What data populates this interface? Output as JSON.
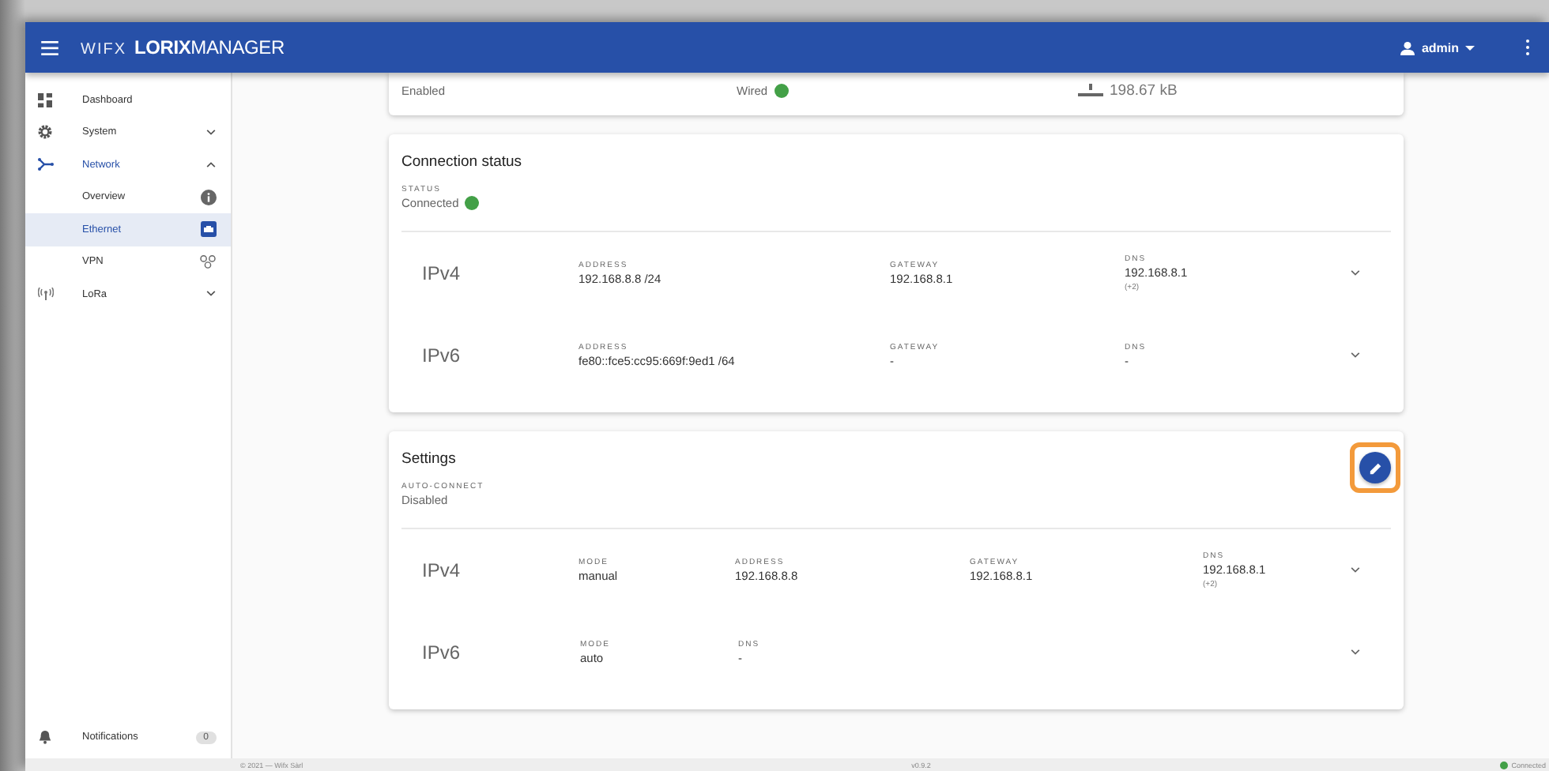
{
  "header": {
    "brand_prefix": "WIFX",
    "brand_bold": "LORIX",
    "brand_rest": "MANAGER",
    "user": "admin"
  },
  "sidebar": {
    "items": [
      {
        "label": "Dashboard",
        "active": false
      },
      {
        "label": "System",
        "active": false,
        "expanded": false
      },
      {
        "label": "Network",
        "active": true,
        "expanded": true,
        "children": [
          {
            "label": "Overview",
            "selected": false
          },
          {
            "label": "Ethernet",
            "selected": true
          },
          {
            "label": "VPN",
            "selected": false
          }
        ]
      },
      {
        "label": "LoRa",
        "active": false,
        "expanded": false
      }
    ],
    "notifications": {
      "label": "Notifications",
      "count": "0"
    }
  },
  "summary_card": {
    "state": "Enabled",
    "link": {
      "text": "Wired",
      "color": "#43a047"
    },
    "received": "198.67 kB"
  },
  "cards": [
    {
      "title": "Connection status",
      "field_label": "STATUS",
      "field_value": "Connected",
      "status": {
        "color": "#43a047"
      },
      "editable": false,
      "rows": [
        {
          "name": "IPv4",
          "expanded": false,
          "fields": [
            {
              "label": "ADDRESS",
              "value": "192.168.8.8 /24"
            },
            {
              "label": "GATEWAY",
              "value": "192.168.8.1"
            },
            {
              "label": "DNS",
              "value": "192.168.8.1",
              "note": "(+2)"
            }
          ]
        },
        {
          "name": "IPv6",
          "expanded": false,
          "fields": [
            {
              "label": "ADDRESS",
              "value": "fe80::fce5:cc95:669f:9ed1 /64"
            },
            {
              "label": "GATEWAY",
              "value": "-"
            },
            {
              "label": "DNS",
              "value": "-"
            }
          ]
        }
      ]
    },
    {
      "title": "Settings",
      "field_label": "AUTO-CONNECT",
      "field_value": "Disabled",
      "editable": true,
      "edit_highlighted": true,
      "rows": [
        {
          "name": "IPv4",
          "expanded": false,
          "fields": [
            {
              "label": "MODE",
              "value": "manual"
            },
            {
              "label": "ADDRESS",
              "value": "192.168.8.8"
            },
            {
              "label": "GATEWAY",
              "value": "192.168.8.1"
            },
            {
              "label": "DNS",
              "value": "192.168.8.1",
              "note": "(+2)"
            }
          ]
        },
        {
          "name": "IPv6",
          "expanded": false,
          "fields": [
            {
              "label": "MODE",
              "value": "auto"
            },
            {
              "label": "DNS",
              "value": "-"
            }
          ]
        }
      ]
    }
  ],
  "footer": {
    "copyright": "© 2021 — Wifx Sàrl",
    "version": "v0.9.2",
    "status": {
      "text": "Connected",
      "color": "#43a047"
    }
  }
}
